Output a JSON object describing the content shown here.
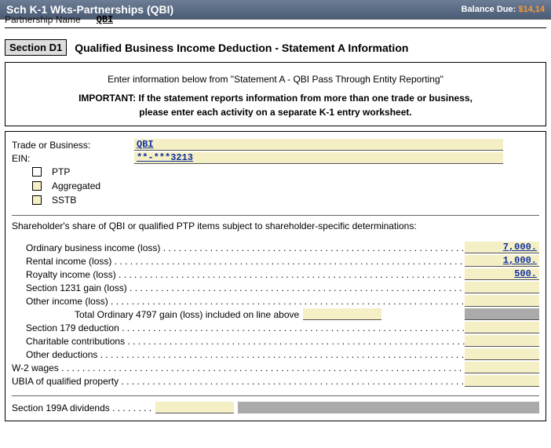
{
  "titlebar": {
    "title": "Sch K-1 Wks-Partnerships (QBI)",
    "balance_label": "Balance Due: ",
    "balance_amount": "$14,14"
  },
  "partner": {
    "label": "Partnership Name",
    "value": "QBI"
  },
  "section": {
    "tag": "Section D1",
    "title": "Qualified Business Income Deduction - Statement A Information"
  },
  "intro": {
    "line1": "Enter information below from \"Statement A - QBI Pass Through Entity Reporting\"",
    "importantA": "IMPORTANT: If the statement reports information from more than one trade or business,",
    "importantB": "please enter each activity on a separate K-1 entry worksheet."
  },
  "fields": {
    "trade_label": "Trade or Business:",
    "trade_value": "QBI",
    "ein_label": "EIN:",
    "ein_value": "**-***3213",
    "ptp": "PTP",
    "aggregated": "Aggregated",
    "sstb": "SSTB"
  },
  "sharetext": "Shareholder's share of QBI or qualified PTP items subject to shareholder-specific determinations:",
  "items": {
    "ordinary": "Ordinary business income (loss)",
    "rental": "Rental income (loss)",
    "royalty": "Royalty income (loss)",
    "s1231": "Section 1231 gain (loss)",
    "other": "Other income (loss)",
    "total4797": "Total Ordinary 4797 gain (loss) included on line above",
    "s179": "Section 179 deduction",
    "charitable": "Charitable contributions",
    "otherded": "Other deductions",
    "w2": "W-2 wages",
    "ubia": "UBIA of qualified property",
    "s199a": "Section 199A dividends"
  },
  "values": {
    "ordinary": "7,000.",
    "rental": "1,000.",
    "royalty": "500.",
    "s1231": "",
    "other": "",
    "total4797": "",
    "s179": "",
    "charitable": "",
    "otherded": "",
    "w2": "",
    "ubia": "",
    "s199a": ""
  }
}
